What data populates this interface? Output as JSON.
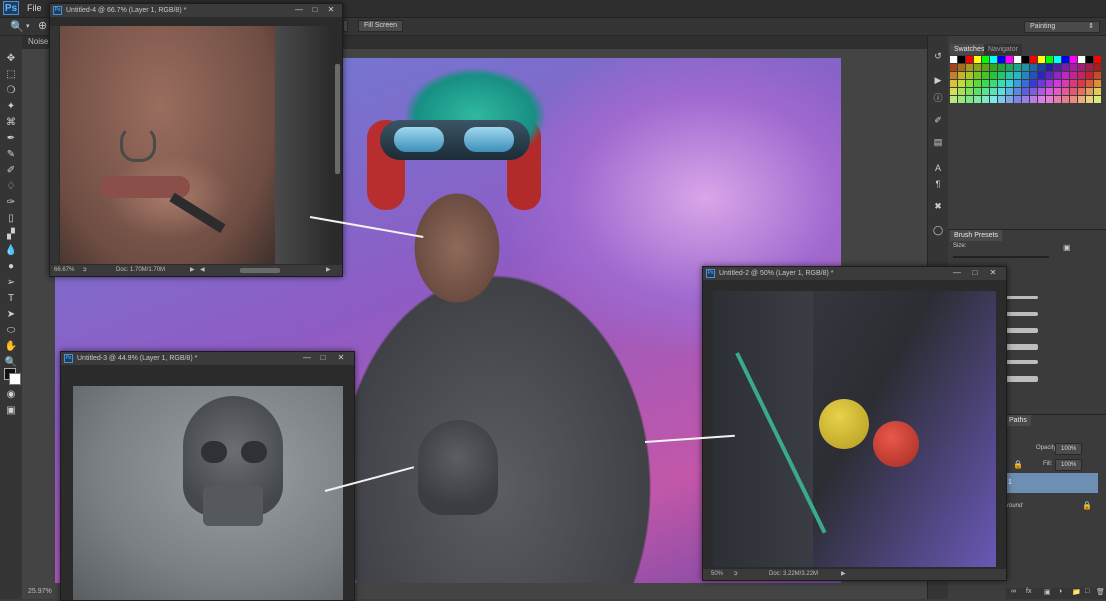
{
  "app": {
    "logo": "Ps",
    "menu": [
      "File"
    ]
  },
  "options_bar": {
    "fill_screen": "Fill Screen",
    "workspace": "Painting"
  },
  "document_tab": {
    "label": "Noise."
  },
  "status": {
    "zoom": "25.97%"
  },
  "windows": {
    "w4": {
      "title": "Untitled-4 @ 66.7% (Layer 1, RGB/8) *",
      "zoom": "66.67%",
      "doc": "Doc: 1.70M/1.70M"
    },
    "w3": {
      "title": "Untitled-3 @ 44.9% (Layer 1, RGB/8) *"
    },
    "w2": {
      "title": "Untitled-2 @ 50% (Layer 1, RGB/8) *",
      "zoom": "50%",
      "doc": "Doc: 3.22M/3.22M"
    }
  },
  "panels": {
    "swatches_tab": "Swatches",
    "navigator_tab": "Navigator",
    "brush_presets_tab": "Brush Presets",
    "size_label": "Size:",
    "paths_tab": "Paths",
    "opacity_label": "Opacity:",
    "opacity_value": "100%",
    "fill_label": "Fill:",
    "fill_value": "100%",
    "layer_name": "1",
    "background_layer": "round"
  },
  "colors": {
    "accent": "#6d8fb3",
    "ps_blue": "#4d8fd0"
  }
}
